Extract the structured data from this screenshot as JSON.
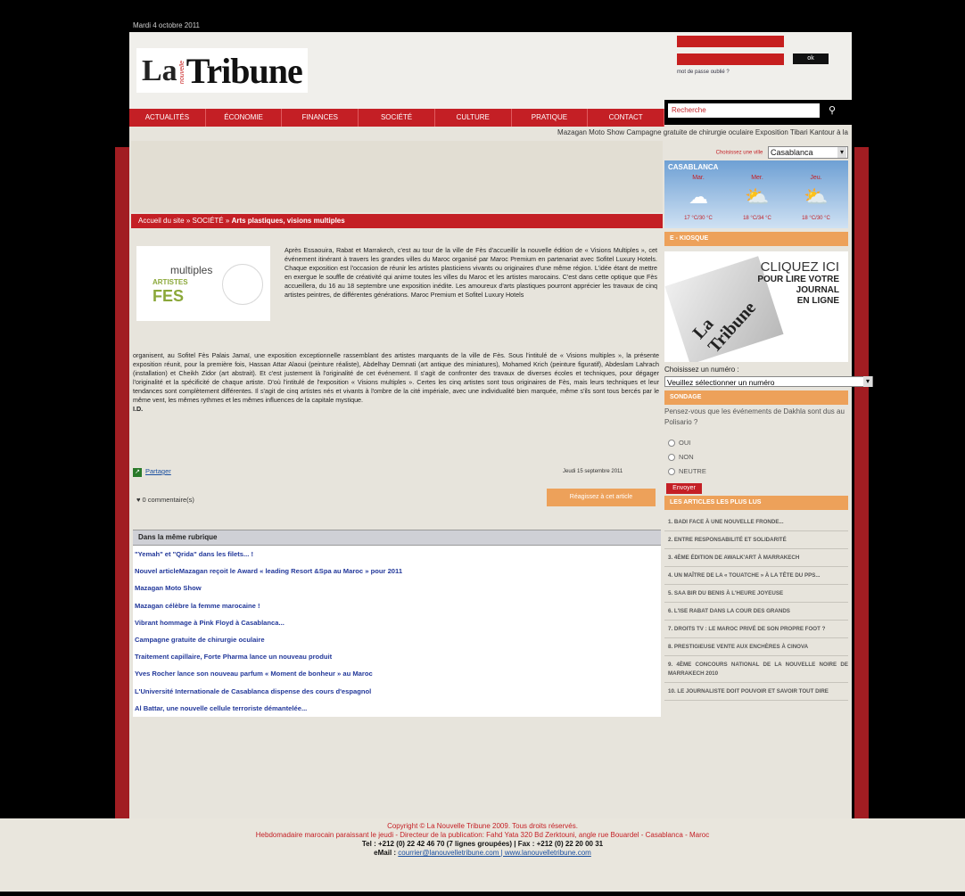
{
  "date": "Mardi 4 octobre 2011",
  "logo": {
    "la": "La",
    "sub": "nouvelle",
    "tribune": "Tribune"
  },
  "login": {
    "ok": "ok",
    "forgot": "mot de passe oublié ?"
  },
  "nav": [
    "ACTUALITÉS",
    "ÉCONOMIE",
    "FINANCES",
    "SOCIÉTÉ",
    "CULTURE",
    "PRATIQUE",
    "CONTACT"
  ],
  "search": {
    "placeholder": "Recherche",
    "icon": "magnifier-icon"
  },
  "ticker": "Mazagan Moto Show   Campagne gratuite de chirurgie oculaire   Exposition Tibari Kantour à la",
  "breadcrumb": {
    "home": "Accueil du site",
    "sep": "»",
    "section": "SOCIÉTÉ",
    "title": "Arts plastiques, visions multiples"
  },
  "article": {
    "image": {
      "t1": "multiples",
      "t2": "ARTISTES",
      "t3": "FES"
    },
    "p1": "Après Essaouira, Rabat et Marrakech, c'est au tour de la ville de Fès d'accueillir la nouvelle édition de « Visions Multiples », cet événement itinérant à travers les grandes villes du Maroc organisé par Maroc Premium en partenariat avec Sofitel Luxury Hotels. Chaque exposition est l'occasion de réunir les artistes plasticiens vivants ou originaires d'une même région. L'idée étant de mettre en exergue le souffle de créativité qui anime toutes les villes du Maroc et les artistes marocains. C'est dans cette optique que Fès accueillera, du 16 au 18 septembre une exposition inédite. Les amoureux d'arts plastiques pourront apprécier les travaux de cinq artistes peintres, de différentes générations. Maroc Premium et Sofitel Luxury Hotels",
    "p2": "organisent, au Sofitel Fès Palais Jamaï, une exposition exceptionnelle rassemblant des artistes marquants de la ville de Fès. Sous l'intitulé de « Visions multiples », la présente exposition réunit, pour la première fois, Hassan Attar Alaoui (peinture réaliste), Abdelhay Demnati (art antique des miniatures), Mohamed Krich (peinture figuratif), Abdeslam Lahrach (installation) et Cheikh Zidor (art abstrait). Et c'est justement là l'originalité de cet événement. Il s'agit de confronter des travaux de diverses écoles et techniques, pour dégager l'originalité et la spécificité de chaque artiste. D'où l'intitulé de l'exposition « Visions multiples ». Certes les cinq artistes sont tous originaires de Fès, mais leurs techniques et leur tendances sont complètement différentes. Il s'agit de cinq artistes nés et vivants à l'ombre de la cité impériale, avec une individualité bien marquée, même s'ils sont tous bercés par le même vent, les mêmes rythmes et les mêmes influences de la capitale mystique.",
    "author": "I.D.",
    "share": "Partager",
    "date": "Jeudi 15 septembre 2011",
    "comments": "0 commentaire(s)",
    "react": "Réagissez à cet article"
  },
  "rubrique": {
    "header": "Dans la même rubrique",
    "items": [
      "\"Yemah\" et \"Qrida\" dans les filets... !",
      "Nouvel articleMazagan reçoit le Award « leading Resort &Spa au Maroc » pour 2011",
      "Mazagan Moto Show",
      "Mazagan célèbre la femme marocaine !",
      "Vibrant hommage à Pink Floyd à Casablanca...",
      "Campagne gratuite de chirurgie oculaire",
      "Traitement capillaire, Forte Pharma lance un nouveau produit",
      "Yves Rocher lance son nouveau parfum « Moment de bonheur » au Maroc",
      "L'Université Internationale de Casablanca dispense des cours d'espagnol",
      "Al Battar, une nouvelle cellule terroriste démantelée..."
    ]
  },
  "sidebar": {
    "city_label": "Choisissez une ville",
    "city": "Casablanca",
    "weather": {
      "city": "CASABLANCA",
      "days": [
        {
          "day": "Mar.",
          "icon": "cloud-icon",
          "temp": "17 °C/30 °C"
        },
        {
          "day": "Mer.",
          "icon": "sun-cloud-icon",
          "temp": "18 °C/34 °C"
        },
        {
          "day": "Jeu.",
          "icon": "sun-cloud-icon",
          "temp": "18 °C/30 °C"
        }
      ]
    },
    "kiosk_header": "E - KIOSQUE",
    "promo": {
      "l1": "CLIQUEZ ICI",
      "l2": "POUR LIRE VOTRE",
      "l3": "JOURNAL",
      "l4": "EN LIGNE",
      "paper": "La Tribune"
    },
    "issue_label": "Choisissez un numéro :",
    "issue_select": "Veuillez sélectionner un numéro",
    "poll_header": "SONDAGE",
    "poll_question": "Pensez-vous que les événements de Dakhla sont dus au Polisario ?",
    "poll_options": [
      "OUI",
      "NON",
      "NEUTRE"
    ],
    "poll_submit": "Envoyer",
    "top_header": "LES ARTICLES LES PLUS LUS",
    "top_articles": [
      "1. BADI FACE À UNE NOUVELLE FRONDE...",
      "2. ENTRE RESPONSABILITÉ ET SOLIDARITÉ",
      "3. 4ÈME ÉDITION DE AWALK'ART À MARRAKECH",
      "4. UN MAÎTRE DE LA « TOUATCHE » À LA TÊTE DU PPS...",
      "5. SAA BIR DU BENIS À L'HEURE JOYEUSE",
      "6. L'ISE RABAT DANS LA COUR DES GRANDS",
      "7. DROITS TV : LE MAROC PRIVÉ DE SON PROPRE FOOT ?",
      "8. PRESTIGIEUSE VENTE AUX ENCHÈRES À CINOVA",
      "9. 4ÈME CONCOURS NATIONAL DE LA NOUVELLE NOIRE DE MARRAKECH 2010",
      "10. LE JOURNALISTE DOIT POUVOIR ET SAVOIR TOUT DIRE"
    ]
  },
  "footer": {
    "l1": "Copyright © La Nouvelle Tribune 2009. Tous droits réservés.",
    "l2": "Hebdomadaire marocain paraissant le jeudi - Directeur de la publication: Fahd Yata 320 Bd Zerktouni, angle rue Bouardel - Casablanca - Maroc",
    "l3": "Tel : +212 (0) 22 42 46 70 (7 lignes groupées) | Fax : +212 (0) 22 20 00 31",
    "l4_label": "eMail : ",
    "l4_links": "courrier@lanouvelletribune.com | www.lanouvelletribune.com"
  },
  "colors": {
    "brand_red": "#c41f25",
    "accent_orange": "#eda15a",
    "link_blue": "#22389a"
  }
}
